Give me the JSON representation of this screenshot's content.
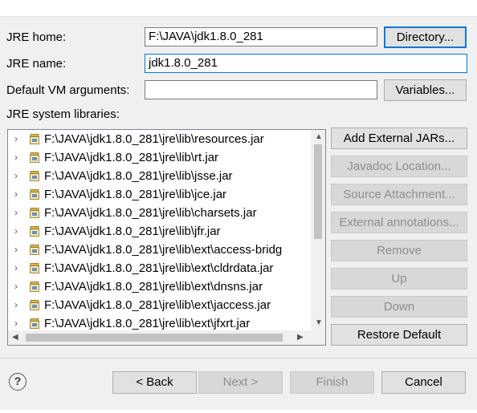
{
  "form": {
    "jre_home_label": "JRE home:",
    "jre_home_value": "F:\\JAVA\\jdk1.8.0_281",
    "directory_button": "Directory...",
    "jre_name_label": "JRE name:",
    "jre_name_value": "jdk1.8.0_281",
    "vm_args_label": "Default VM arguments:",
    "vm_args_value": "",
    "variables_button": "Variables...",
    "libraries_label": "JRE system libraries:"
  },
  "libraries": [
    "F:\\JAVA\\jdk1.8.0_281\\jre\\lib\\resources.jar",
    "F:\\JAVA\\jdk1.8.0_281\\jre\\lib\\rt.jar",
    "F:\\JAVA\\jdk1.8.0_281\\jre\\lib\\jsse.jar",
    "F:\\JAVA\\jdk1.8.0_281\\jre\\lib\\jce.jar",
    "F:\\JAVA\\jdk1.8.0_281\\jre\\lib\\charsets.jar",
    "F:\\JAVA\\jdk1.8.0_281\\jre\\lib\\jfr.jar",
    "F:\\JAVA\\jdk1.8.0_281\\jre\\lib\\ext\\access-bridg",
    "F:\\JAVA\\jdk1.8.0_281\\jre\\lib\\ext\\cldrdata.jar",
    "F:\\JAVA\\jdk1.8.0_281\\jre\\lib\\ext\\dnsns.jar",
    "F:\\JAVA\\jdk1.8.0_281\\jre\\lib\\ext\\jaccess.jar",
    "F:\\JAVA\\jdk1.8.0_281\\jre\\lib\\ext\\jfxrt.jar"
  ],
  "side_buttons": {
    "add_external_jars": "Add External JARs...",
    "javadoc_location": "Javadoc Location...",
    "source_attachment": "Source Attachment...",
    "external_annotations": "External annotations...",
    "remove": "Remove",
    "up": "Up",
    "down": "Down",
    "restore_default": "Restore Default"
  },
  "footer": {
    "help": "?",
    "back": "< Back",
    "next": "Next >",
    "finish": "Finish",
    "cancel": "Cancel"
  },
  "colors": {
    "focus_border": "#0078d7",
    "disabled_text": "#8d8d8d"
  },
  "icons": {
    "jar": "jar-file-icon",
    "expand": "chevron-right-icon"
  }
}
